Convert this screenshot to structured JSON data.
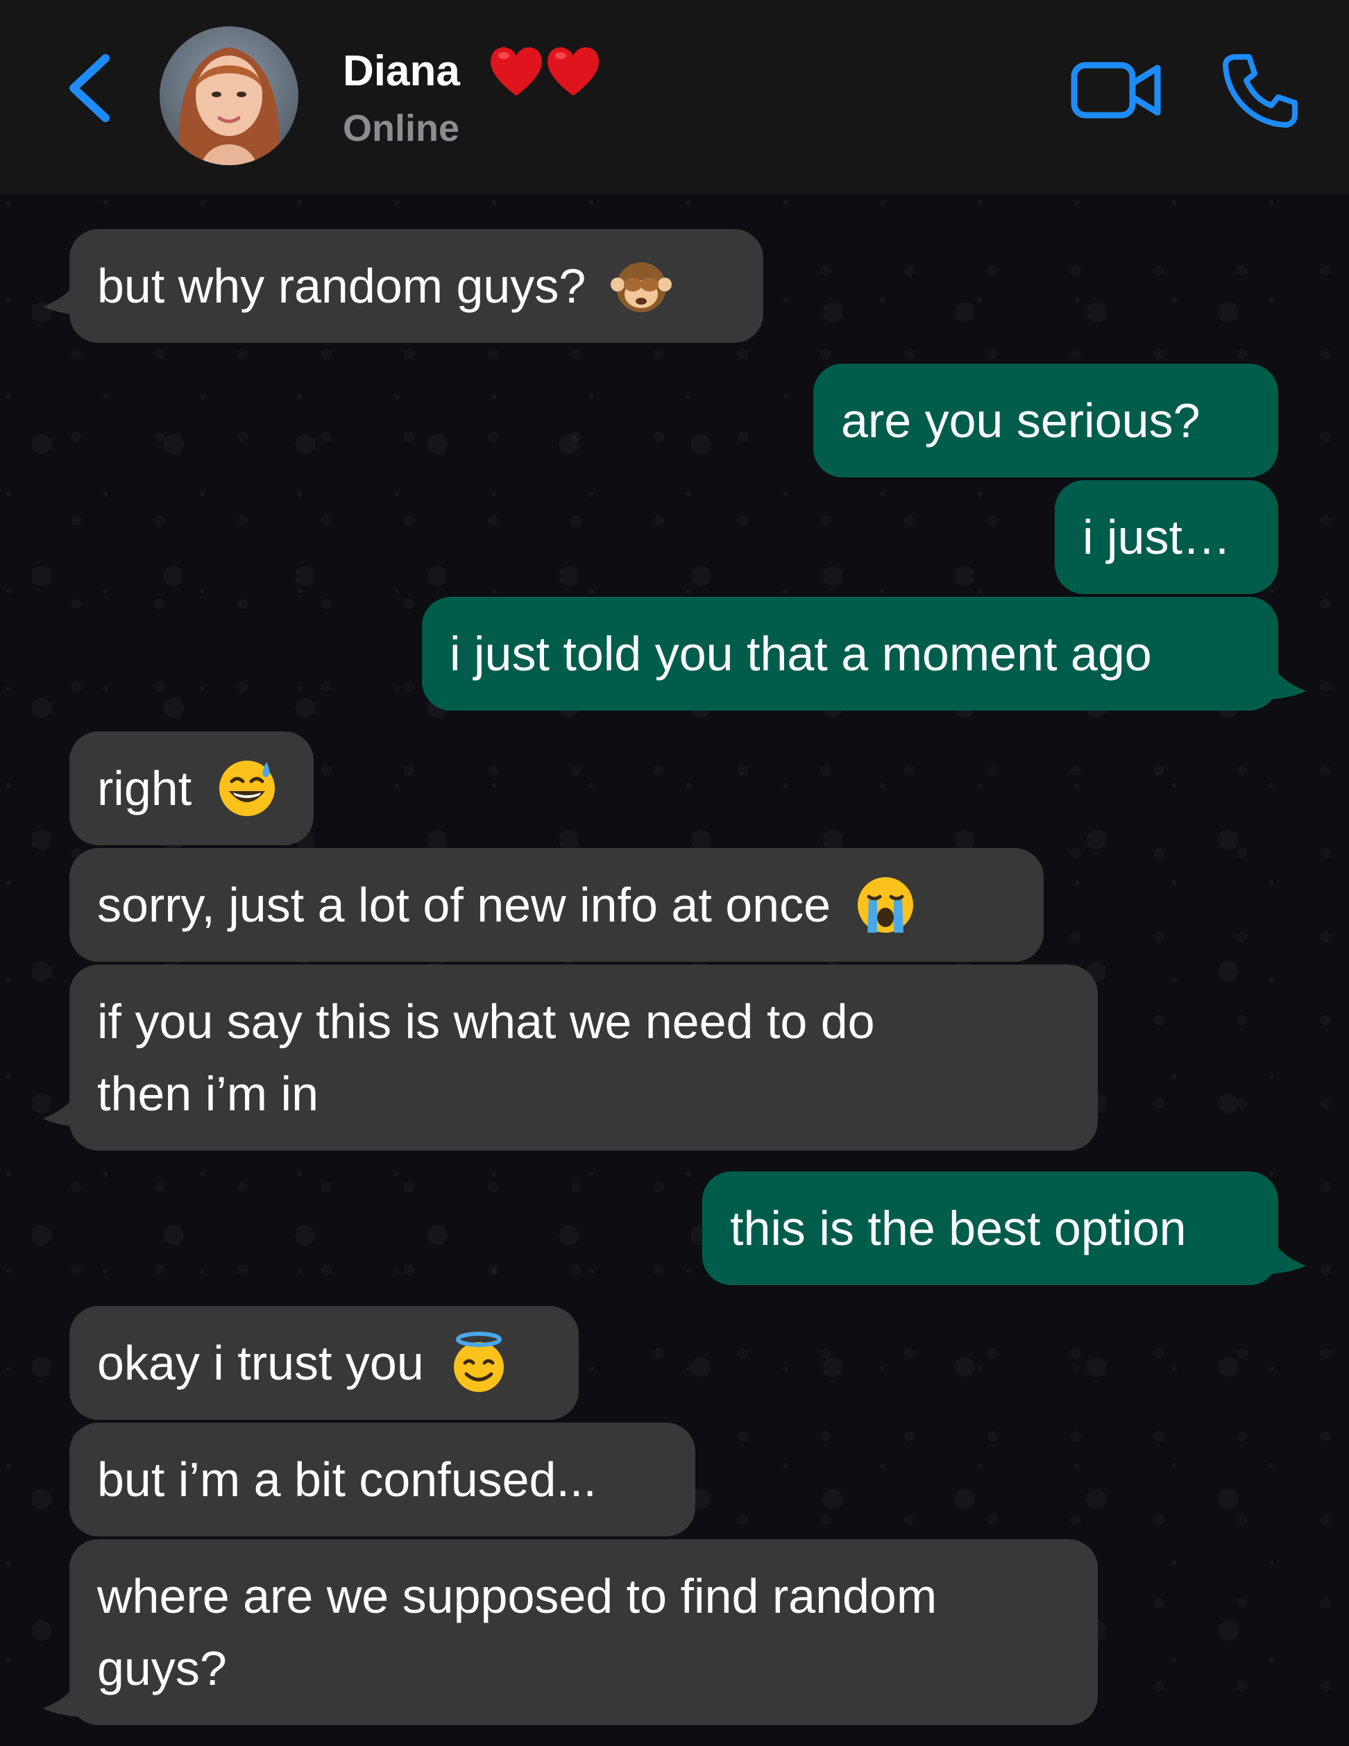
{
  "header": {
    "contact_name": "Diana",
    "status": "Online",
    "back_icon": "chevron-left-icon",
    "video_icon": "video-camera-icon",
    "call_icon": "phone-icon",
    "name_emoji": "two-red-hearts",
    "accent_color": "#1d8cf8"
  },
  "colors": {
    "incoming_bubble": "#383838",
    "outgoing_bubble": "#005c4b",
    "header_bg": "#161616",
    "status_text": "#8d8d91"
  },
  "messages": [
    {
      "direction": "in",
      "text": "but why random guys?",
      "emoji": "see-no-evil-monkey"
    },
    {
      "direction": "out",
      "text": "are you serious?"
    },
    {
      "direction": "out",
      "text": "i just…"
    },
    {
      "direction": "out",
      "text": "i just told you that a moment ago"
    },
    {
      "direction": "in",
      "text": "right",
      "emoji": "grinning-face-with-sweat"
    },
    {
      "direction": "in",
      "text": "sorry, just a lot of new info at once",
      "emoji": "loudly-crying-face"
    },
    {
      "direction": "in",
      "line1": "if you say this is what we need to do",
      "line2": "then i’m in"
    },
    {
      "direction": "out",
      "text": "this is the best option"
    },
    {
      "direction": "in",
      "text": "okay i trust you",
      "emoji": "smiling-face-with-halo"
    },
    {
      "direction": "in",
      "text": "but i’m a bit confused..."
    },
    {
      "direction": "in",
      "line1": "where are we supposed to find random",
      "line2": "guys?"
    }
  ]
}
